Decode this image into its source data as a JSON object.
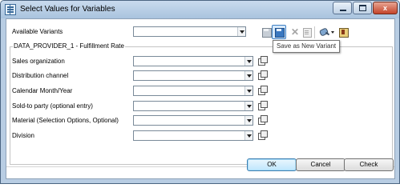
{
  "window": {
    "title": "Select Values for Variables",
    "close_glyph": "x"
  },
  "variants": {
    "label": "Available Variants",
    "value": ""
  },
  "toolbar": {
    "icons": [
      "save-variant-icon",
      "save-as-new-variant-icon",
      "delete-variant-icon",
      "variant-properties-icon",
      "personalize-icon",
      "info-icon"
    ],
    "tooltip": "Save as New Variant"
  },
  "group": {
    "title": "DATA_PROVIDER_1 - Fulfillment Rate",
    "fields": [
      {
        "label": "Sales organization",
        "value": ""
      },
      {
        "label": "Distribution channel",
        "value": ""
      },
      {
        "label": "Calendar Month/Year",
        "value": ""
      },
      {
        "label": "Sold-to party (optional entry)",
        "value": ""
      },
      {
        "label": "Material (Selection Options, Optional)",
        "value": ""
      },
      {
        "label": "Division",
        "value": ""
      }
    ]
  },
  "buttons": {
    "ok": "OK",
    "cancel": "Cancel",
    "check": "Check"
  },
  "colors": {
    "frame": "#b8cde3",
    "ok_button": "#bee6fd",
    "close_button": "#c4442a"
  }
}
